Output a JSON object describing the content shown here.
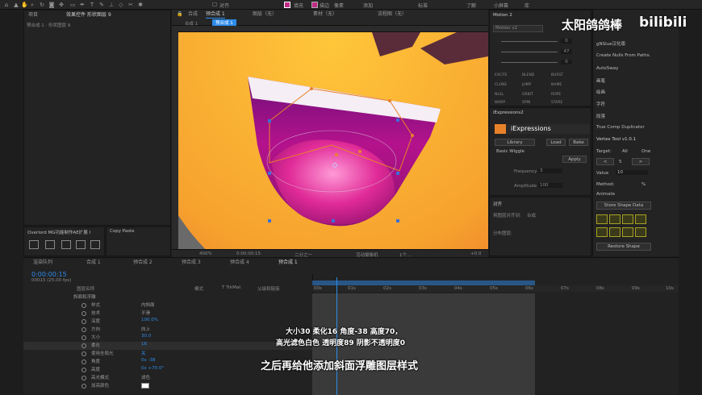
{
  "toolbar": {
    "align_label": "对齐",
    "fill_label": "填充",
    "stroke_label": "描边",
    "stroke_value": "像素",
    "add_label": "添加",
    "workspaces": [
      "标准",
      "小屏幕",
      "库"
    ],
    "learn_label": "了解"
  },
  "project_panel": {
    "tab_project": "项目",
    "tab_effects": "效果控件 形状图层 9",
    "breadcrumb": "预合成 1 · 形状图层 9"
  },
  "comp_tabs": {
    "prefix": "合成",
    "active": "预合成 1",
    "layer_tab": "图层（无）",
    "footage_tab": "素材（无）",
    "flow_tab": "流程图（无）",
    "breadcrumb_left": "合成 1",
    "breadcrumb_right": "预合成 1"
  },
  "viewer_footer": {
    "zoom": "400%",
    "timecode": "0:00:00:15",
    "resolution": "二分之一",
    "camera": "活动摄像机",
    "views": "1个...",
    "exposure": "+0.0"
  },
  "lower_left_panels": {
    "overlord": "Overlord MG功能制作AE扩展 I",
    "copy_paste": "Copy Paste"
  },
  "motion_panel": {
    "title": "Motion 2",
    "version": "Motion v2",
    "slider_values": [
      "0",
      "47",
      "0"
    ],
    "buttons": [
      "EXCITE",
      "BLEND",
      "BURST",
      "CLONE",
      "JUMP",
      "NAME",
      "NULL",
      "ORBIT",
      "ROPE",
      "WARP",
      "SPIN",
      "STARE"
    ]
  },
  "iexpressions": {
    "title": "iExpressions2",
    "logo_text": "iExpressions",
    "tabs": [
      "Library",
      "Load",
      "Bake"
    ],
    "preset": "Basic Wiggle",
    "apply_label": "Apply",
    "frequency_label": "Frequency",
    "frequency_value": "3",
    "amplitude_label": "Amplitude",
    "amplitude_value": "100"
  },
  "align_panel": {
    "title": "对齐",
    "align_to_label": "将图层对齐到:",
    "align_to_value": "合成",
    "distribute_label": "分布图层:"
  },
  "right_panel": {
    "items": [
      "gNSlue汉化版",
      "Create Nulls From Paths.",
      "AutoSway",
      "画笔",
      "绘画",
      "字符",
      "段落",
      "True Comp Duplicator"
    ],
    "vertex_title": "Vertex Tool v1.0.1",
    "target_label": "Target:",
    "target_all": "All",
    "target_one": "One",
    "value_label": "Value",
    "value_number": "10",
    "step_number": "5",
    "method_label": "Method:",
    "method_percent": "%",
    "animate_label": "Animate",
    "store_label": "Store Shape Data",
    "restore_label": "Restore Shape"
  },
  "watermark": {
    "text": "太阳鸽鸽棒",
    "logo": "bilibili"
  },
  "timeline": {
    "tabs": [
      "渲染队列",
      "合成 1",
      "预合成 2",
      "预合成 3",
      "预合成 4",
      "预合成 1"
    ],
    "timecode": "0:00:00:15",
    "frame_info": "00015 (25.00 fps)",
    "columns": [
      "图层名称",
      "模式",
      "T TrkMat",
      "父级和链接"
    ],
    "properties": [
      {
        "name": "斜面和浮雕",
        "value": ""
      },
      {
        "name": "样式",
        "value": "内斜面"
      },
      {
        "name": "技术",
        "value": "平滑"
      },
      {
        "name": "深度",
        "value": "100.0%"
      },
      {
        "name": "方向",
        "value": "向上"
      },
      {
        "name": "大小",
        "value": "30.0"
      },
      {
        "name": "柔化",
        "value": "16"
      },
      {
        "name": "使用全局光",
        "value": "关"
      },
      {
        "name": "角度",
        "value": "0x -38"
      },
      {
        "name": "高度",
        "value": "0x +70.0°"
      },
      {
        "name": "高光模式",
        "value": "滤色"
      },
      {
        "name": "加亮颜色",
        "value": ""
      }
    ],
    "ruler_marks": [
      "00s",
      "01s",
      "02s",
      "03s",
      "04s",
      "05s",
      "06s",
      "07s",
      "08s",
      "09s",
      "10s"
    ]
  },
  "subtitles": {
    "line1": "大小30  柔化16  角度-38  高度70，",
    "line2": "高光滤色白色  透明度89  阴影不透明度0",
    "line3": "之后再给他添加斜面浮雕图层样式"
  },
  "colors": {
    "accent_blue": "#2d8ceb",
    "emoji_yellow": "#f7b52c",
    "mouth_magenta": "#b1127f",
    "path_orange": "#e8822a"
  }
}
